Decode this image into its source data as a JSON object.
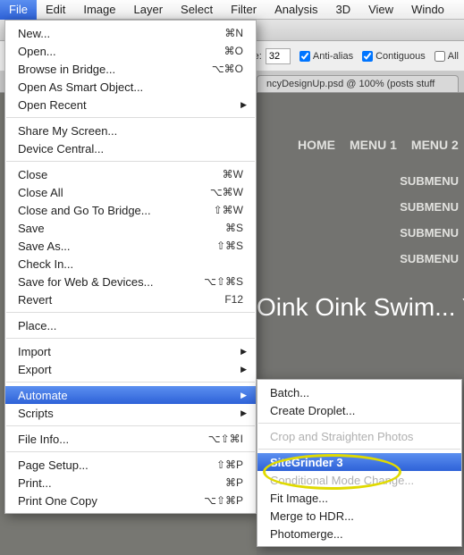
{
  "menubar": [
    "File",
    "Edit",
    "Image",
    "Layer",
    "Select",
    "Filter",
    "Analysis",
    "3D",
    "View",
    "Windo"
  ],
  "toolstrip": {
    "tolerance_label": "olerance:",
    "tolerance_value": "32",
    "antialias": "Anti-alias",
    "contiguous": "Contiguous",
    "all": "All"
  },
  "doctab": "ncyDesignUp.psd @ 100% (posts stuff",
  "canvas": {
    "nav": [
      "HOME",
      "MENU 1",
      "MENU 2"
    ],
    "subnav": [
      "SUBMENU",
      "SUBMENU",
      "SUBMENU",
      "SUBMENU"
    ],
    "headline": "Oink Oink Swim...  Y"
  },
  "file_menu": [
    {
      "label": "New...",
      "sc": "⌘N"
    },
    {
      "label": "Open...",
      "sc": "⌘O"
    },
    {
      "label": "Browse in Bridge...",
      "sc": "⌥⌘O"
    },
    {
      "label": "Open As Smart Object..."
    },
    {
      "label": "Open Recent",
      "arrow": true
    },
    {
      "sep": true
    },
    {
      "label": "Share My Screen..."
    },
    {
      "label": "Device Central..."
    },
    {
      "sep": true
    },
    {
      "label": "Close",
      "sc": "⌘W"
    },
    {
      "label": "Close All",
      "sc": "⌥⌘W"
    },
    {
      "label": "Close and Go To Bridge...",
      "sc": "⇧⌘W"
    },
    {
      "label": "Save",
      "sc": "⌘S"
    },
    {
      "label": "Save As...",
      "sc": "⇧⌘S"
    },
    {
      "label": "Check In..."
    },
    {
      "label": "Save for Web & Devices...",
      "sc": "⌥⇧⌘S"
    },
    {
      "label": "Revert",
      "sc": "F12"
    },
    {
      "sep": true
    },
    {
      "label": "Place..."
    },
    {
      "sep": true
    },
    {
      "label": "Import",
      "arrow": true
    },
    {
      "label": "Export",
      "arrow": true
    },
    {
      "sep": true
    },
    {
      "label": "Automate",
      "arrow": true,
      "sel": true
    },
    {
      "label": "Scripts",
      "arrow": true
    },
    {
      "sep": true
    },
    {
      "label": "File Info...",
      "sc": "⌥⇧⌘I"
    },
    {
      "sep": true
    },
    {
      "label": "Page Setup...",
      "sc": "⇧⌘P"
    },
    {
      "label": "Print...",
      "sc": "⌘P"
    },
    {
      "label": "Print One Copy",
      "sc": "⌥⇧⌘P"
    }
  ],
  "automate_menu": [
    {
      "label": "Batch..."
    },
    {
      "label": "Create Droplet..."
    },
    {
      "sep": true
    },
    {
      "label": "Crop and Straighten Photos",
      "dis": true
    },
    {
      "sep": true
    },
    {
      "label": "SiteGrinder 3",
      "sel": true
    },
    {
      "label": "Conditional Mode Change...",
      "dis": true
    },
    {
      "label": "Fit Image..."
    },
    {
      "label": "Merge to HDR..."
    },
    {
      "label": "Photomerge..."
    }
  ]
}
